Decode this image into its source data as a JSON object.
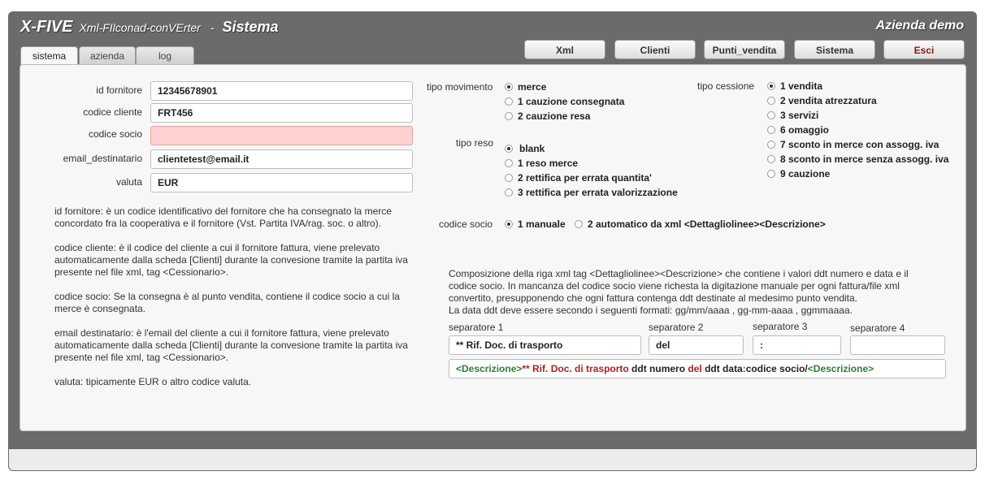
{
  "header": {
    "brand": "X-FIVE",
    "subtitle": "Xml-FIlconad-conVErter",
    "dash": "-",
    "section": "Sistema",
    "company": "Azienda demo"
  },
  "nav_buttons": [
    "Xml",
    "Clienti",
    "Punti_vendita",
    "Sistema",
    "Esci"
  ],
  "tabs": [
    "sistema",
    "azienda",
    "log"
  ],
  "form": {
    "id_fornitore": {
      "label": "id fornitore",
      "value": "12345678901"
    },
    "codice_cliente": {
      "label": "codice cliente",
      "value": "FRT456"
    },
    "codice_socio": {
      "label": "codice socio",
      "value": ""
    },
    "email_destinatario": {
      "label": "email_destinatario",
      "value": "clientetest@email.it"
    },
    "valuta": {
      "label": "valuta",
      "value": "EUR"
    }
  },
  "help": [
    "id fornitore: è un codice identificativo del fornitore che ha consegnato la merce concordato fra la cooperativa e il fornitore (Vst. Partita IVA/rag. soc. o altro).",
    "codice cliente: è il codice del cliente a cui il fornitore fattura, viene prelevato automaticamente dalla scheda [Clienti] durante la convesione tramite la partita iva presente nel file xml, tag <Cessionario>.",
    "codice socio: Se la consegna è al punto vendita, contiene il codice socio a cui la merce è consegnata.",
    "email destinatario: è l'email del cliente a cui il fornitore fattura, viene prelevato automaticamente dalla scheda [Clienti] durante la convesione tramite la partita iva presente nel file xml, tag <Cessionario>.",
    "valuta: tipicamente EUR o altro codice valuta."
  ],
  "tipo_movimento": {
    "label": "tipo movimento",
    "options": [
      "merce",
      "1 cauzione consegnata",
      "2 cauzione resa"
    ],
    "selected": 0
  },
  "tipo_reso": {
    "label": "tipo reso",
    "options": [
      "blank",
      "1 reso merce",
      "2 rettifica per errata quantita'",
      "3 rettifica per errata valorizzazione"
    ],
    "selected": 0
  },
  "tipo_cessione": {
    "label": "tipo cessione",
    "options": [
      "1 vendita",
      "2 vendita atrezzatura",
      "3 servizi",
      "6 omaggio",
      "7 sconto in merce con assogg. iva",
      "8 sconto in merce senza assogg. iva",
      "9 cauzione"
    ],
    "selected": 0
  },
  "codice_socio_mode": {
    "label": "codice socio",
    "options": [
      "1 manuale",
      "2 automatico da xml <Dettagliolinee><Descrizione>"
    ],
    "selected": 0
  },
  "composizione": {
    "text": "Composizione della riga xml tag <Dettagliolinee><Descrizione> che contiene i valori ddt numero e data e il codice socio. In mancanza del codice socio viene richesta la digitazione manuale per ogni fattura/file xml convertito, presupponendo che ogni fattura contenga ddt destinate al medesimo punto vendita.",
    "date_note": "La data ddt deve essere secondo i seguenti formati: gg/mm/aaaa , gg-mm-aaaa , ggmmaaaa."
  },
  "separators": [
    {
      "label": "separatore 1",
      "value": "** Rif. Doc. di trasporto"
    },
    {
      "label": "separatore 2",
      "value": "del"
    },
    {
      "label": "separatore 3",
      "value": ":"
    },
    {
      "label": "separatore 4",
      "value": ""
    }
  ],
  "preview": {
    "open_tag": "<Descrizione>",
    "sep1": "** Rif. Doc. di trasporto",
    "ddt_numero": " ddt numero ",
    "sep2": "del",
    "ddt_data": " ddt data",
    "sep3": ":",
    "codice_socio": "codice socio/",
    "close_tag": "<Descrizione>"
  }
}
